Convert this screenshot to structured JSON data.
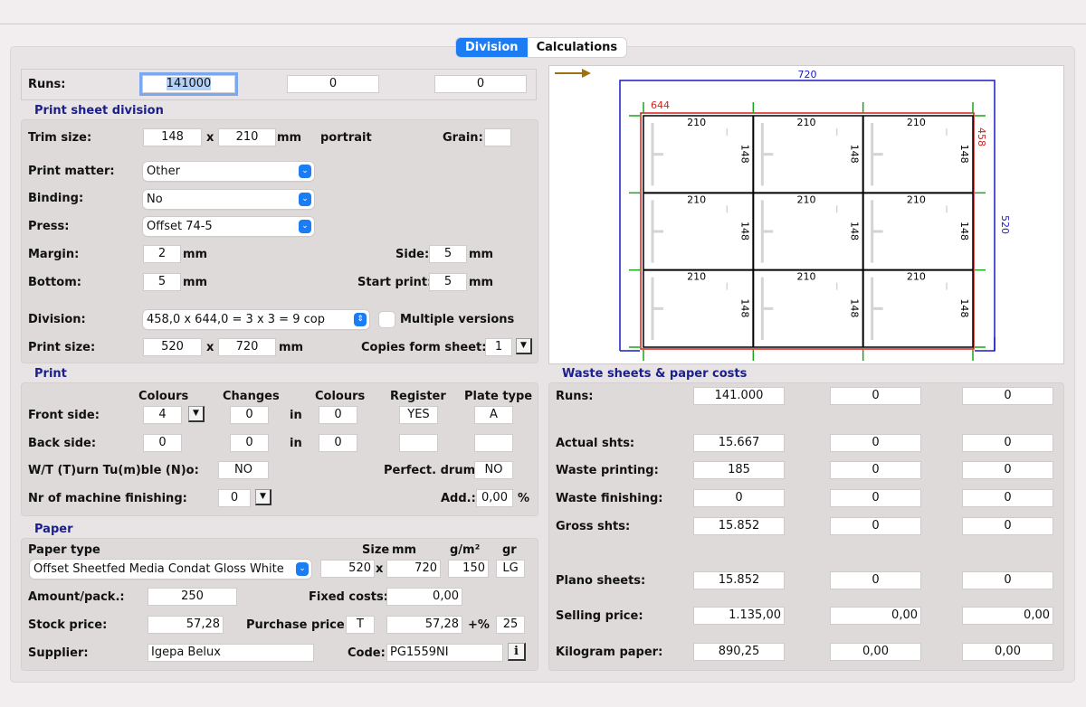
{
  "tabs": [
    {
      "label": "Division",
      "active": true
    },
    {
      "label": "Calculations",
      "active": false
    }
  ],
  "runs": {
    "label": "Runs:",
    "values": [
      "141000",
      "0",
      "0"
    ]
  },
  "print_sheet_division": {
    "title": "Print sheet division",
    "trim_size": {
      "label": "Trim size:",
      "width": "148",
      "x": "x",
      "height": "210",
      "unit": "mm",
      "orientation": "portrait"
    },
    "grain": {
      "label": "Grain:",
      "value": ""
    },
    "print_matter": {
      "label": "Print matter:",
      "value": "Other"
    },
    "binding": {
      "label": "Binding:",
      "value": "No"
    },
    "press": {
      "label": "Press:",
      "value": "Offset 74-5"
    },
    "margin": {
      "label": "Margin:",
      "value": "2",
      "unit": "mm"
    },
    "side": {
      "label": "Side:",
      "value": "5",
      "unit": "mm"
    },
    "bottom": {
      "label": "Bottom:",
      "value": "5",
      "unit": "mm"
    },
    "start_print": {
      "label": "Start print:",
      "value": "5",
      "unit": "mm"
    },
    "division": {
      "label": "Division:",
      "value": "458,0 x 644,0 = 3 x 3 = 9 cop"
    },
    "multiple_versions": {
      "label": "Multiple versions",
      "checked": false
    },
    "print_size": {
      "label": "Print size:",
      "width": "520",
      "x": "x",
      "height": "720",
      "unit": "mm"
    },
    "copies_form_sheet": {
      "label": "Copies form sheet:",
      "value": "1"
    }
  },
  "print": {
    "title": "Print",
    "headers": [
      "Colours",
      "Changes",
      "Colours",
      "Register",
      "Plate type"
    ],
    "in_label": "in",
    "front": {
      "label": "Front side:",
      "colours": "4",
      "changes": "0",
      "in_colours": "0",
      "register": "YES",
      "plate": "A"
    },
    "back": {
      "label": "Back side:",
      "colours": "0",
      "changes": "0",
      "in_colours": "0",
      "register": "",
      "plate": ""
    },
    "wt": {
      "label": "W/T (T)urn Tu(m)ble (N)o:",
      "value": "NO"
    },
    "perfect_drum": {
      "label": "Perfect. drum:",
      "value": "NO"
    },
    "machine_finishing": {
      "label": "Nr of machine finishing:",
      "value": "0"
    },
    "add": {
      "label": "Add.:",
      "value": "0,00",
      "unit": "%"
    }
  },
  "paper": {
    "title": "Paper",
    "type_label": "Paper type",
    "type_value": "Offset Sheetfed Media Condat Gloss White",
    "size_label": "Size",
    "mm_label": "mm",
    "gsm_label": "g/m²",
    "gr_label": "gr",
    "size_w": "520",
    "x": "x",
    "size_h": "720",
    "gsm": "150",
    "gr": "LG",
    "amount_pack": {
      "label": "Amount/pack.:",
      "value": "250"
    },
    "fixed_costs": {
      "label": "Fixed costs:",
      "value": "0,00"
    },
    "stock_price": {
      "label": "Stock price:",
      "value": "57,28"
    },
    "purchase_price": {
      "label": "Purchase price:",
      "flag": "T",
      "value": "57,28",
      "plus_label": "+%",
      "plus_value": "25"
    },
    "supplier": {
      "label": "Supplier:",
      "value": "Igepa Belux"
    },
    "code": {
      "label": "Code:",
      "value": "PG1559NI",
      "info": "i"
    }
  },
  "diagram": {
    "sheet_width_label": "720",
    "sheet_height_label": "520",
    "print_width_label": "644",
    "print_height_label": "458",
    "cell_width_label": "210",
    "cell_height_label": "148",
    "rows": 3,
    "cols": 3,
    "colors": {
      "sheet": "#1a1ac8",
      "print": "#d42020",
      "marks": "#19a619",
      "arrow": "#a0720e"
    }
  },
  "waste": {
    "title": "Waste sheets & paper costs",
    "rows": [
      {
        "label": "Runs:",
        "values": [
          "141.000",
          "0",
          "0"
        ]
      },
      {
        "label": "Actual shts:",
        "values": [
          "15.667",
          "0",
          "0"
        ]
      },
      {
        "label": "Waste printing:",
        "values": [
          "185",
          "0",
          "0"
        ]
      },
      {
        "label": "Waste finishing:",
        "values": [
          "0",
          "0",
          "0"
        ]
      },
      {
        "label": "Gross shts:",
        "values": [
          "15.852",
          "0",
          "0"
        ]
      },
      {
        "label": "Plano sheets:",
        "values": [
          "15.852",
          "0",
          "0"
        ]
      },
      {
        "label": "Selling price:",
        "values": [
          "1.135,00",
          "0,00",
          "0,00"
        ]
      },
      {
        "label": "Kilogram paper:",
        "values": [
          "890,25",
          "0,00",
          "0,00"
        ]
      }
    ]
  }
}
